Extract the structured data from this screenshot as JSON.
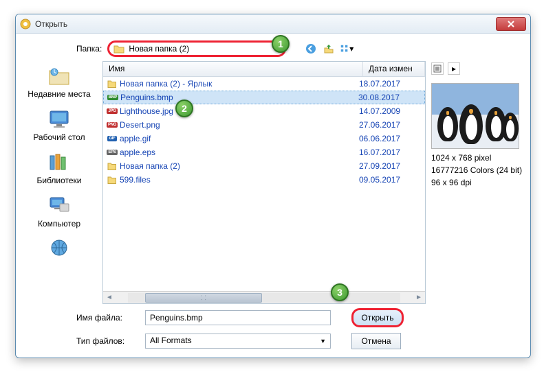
{
  "window": {
    "title": "Открыть"
  },
  "folder": {
    "label": "Папка:",
    "value": "Новая папка (2)"
  },
  "places": {
    "recent": "Недавние места",
    "desktop": "Рабочий стол",
    "libraries": "Библиотеки",
    "computer": "Компьютер"
  },
  "columns": {
    "name": "Имя",
    "date": "Дата измен"
  },
  "files": [
    {
      "icon": "folder-shortcut",
      "name": "Новая папка (2) - Ярлык",
      "date": "18.07.2017",
      "sel": false
    },
    {
      "icon": "bmp",
      "name": "Penguins.bmp",
      "date": "30.08.2017",
      "sel": true
    },
    {
      "icon": "jpg",
      "name": "Lighthouse.jpg",
      "date": "14.07.2009",
      "sel": false
    },
    {
      "icon": "png",
      "name": "Desert.png",
      "date": "27.06.2017",
      "sel": false
    },
    {
      "icon": "gif",
      "name": "apple.gif",
      "date": "06.06.2017",
      "sel": false
    },
    {
      "icon": "eps",
      "name": "apple.eps",
      "date": "16.07.2017",
      "sel": false
    },
    {
      "icon": "folder",
      "name": "Новая папка (2)",
      "date": "27.09.2017",
      "sel": false
    },
    {
      "icon": "folder",
      "name": "599.files",
      "date": "09.05.2017",
      "sel": false
    }
  ],
  "preview": {
    "dims": "1024 x 768 pixel",
    "colors": "16777216 Colors (24 bit)",
    "dpi": "96 x 96 dpi"
  },
  "filename": {
    "label": "Имя файла:",
    "value": "Penguins.bmp"
  },
  "filetype": {
    "label": "Тип файлов:",
    "value": "All Formats"
  },
  "buttons": {
    "open": "Открыть",
    "cancel": "Отмена"
  },
  "callouts": {
    "c1": "1",
    "c2": "2",
    "c3": "3"
  }
}
